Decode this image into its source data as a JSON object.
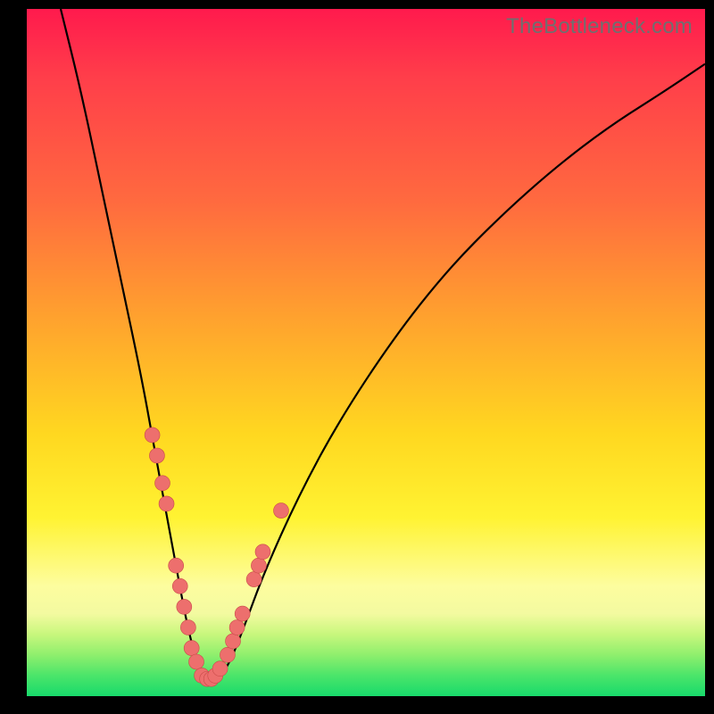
{
  "watermark": "TheBottleneck.com",
  "chart_data": {
    "type": "line",
    "title": "",
    "xlabel": "",
    "ylabel": "",
    "xlim": [
      0,
      100
    ],
    "ylim": [
      0,
      100
    ],
    "grid": false,
    "legend": false,
    "series": [
      {
        "name": "bottleneck-curve",
        "x": [
          5,
          8,
          11,
          14,
          17,
          19,
          20.5,
          22,
          23.5,
          25,
          26.5,
          28,
          30,
          32,
          35,
          40,
          46,
          54,
          62,
          70,
          78,
          86,
          94,
          100
        ],
        "y": [
          100,
          88,
          74,
          60,
          46,
          35,
          27,
          19,
          11,
          5,
          2,
          2,
          5,
          10,
          18,
          29,
          40,
          52,
          62,
          70,
          77,
          83,
          88,
          92
        ]
      }
    ],
    "points": {
      "name": "sample-markers",
      "x": [
        18.5,
        19.2,
        20.0,
        20.6,
        22.0,
        22.6,
        23.2,
        23.8,
        24.3,
        25.0,
        25.8,
        26.6,
        27.2,
        27.8,
        28.5,
        29.6,
        30.4,
        31.0,
        31.8,
        33.5,
        34.2,
        34.8
      ],
      "y": [
        38,
        35,
        31,
        28,
        19,
        16,
        13,
        10,
        7,
        5,
        3,
        2.5,
        2.5,
        3,
        4,
        6,
        8,
        10,
        12,
        17,
        19,
        21
      ]
    },
    "extra_point": {
      "x": 37.5,
      "y": 27
    }
  },
  "colors": {
    "marker_fill": "#ed6f6d",
    "marker_stroke": "#c94b49",
    "curve": "#000000"
  }
}
